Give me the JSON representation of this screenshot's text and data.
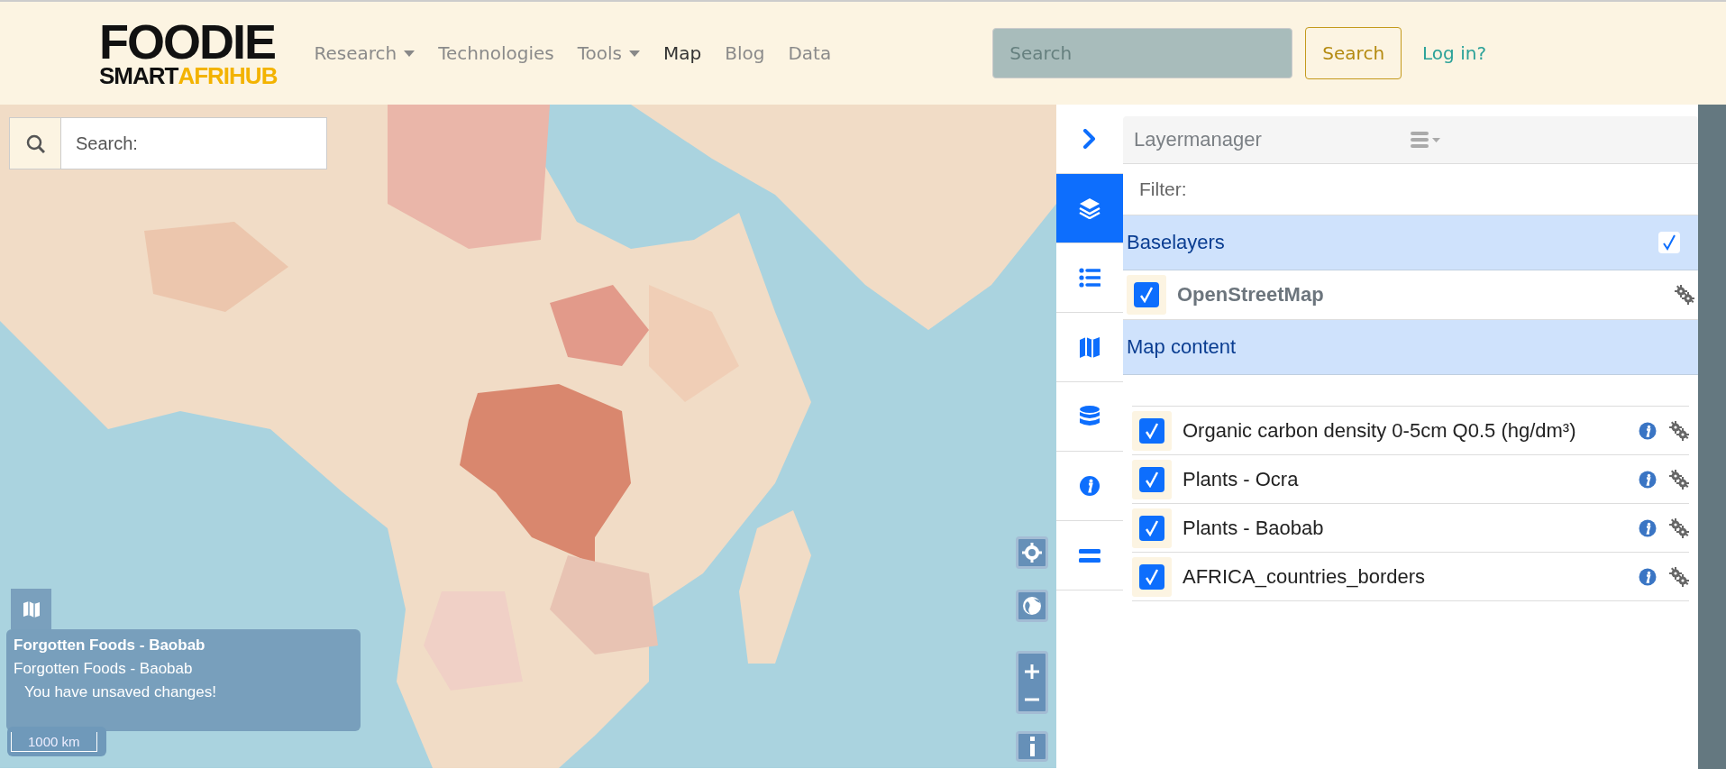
{
  "header": {
    "logo": {
      "title": "FOODIE",
      "subtitle_part_1": "SMART",
      "subtitle_part_2": "AFRIHUB"
    },
    "nav": [
      {
        "label": "Research",
        "dropdown": true,
        "selected": false
      },
      {
        "label": "Technologies",
        "dropdown": false,
        "selected": false
      },
      {
        "label": "Tools",
        "dropdown": true,
        "selected": false
      },
      {
        "label": "Map",
        "dropdown": false,
        "selected": true
      },
      {
        "label": "Blog",
        "dropdown": false,
        "selected": false
      },
      {
        "label": "Data",
        "dropdown": false,
        "selected": false
      }
    ],
    "search": {
      "placeholder": "Search"
    },
    "search_button": "Search",
    "login": "Log in?"
  },
  "map": {
    "kind": "picture",
    "search": {
      "placeholder": "Search:"
    },
    "info_box": {
      "title": "Forgotten Foods - Baobab",
      "name": "Forgotten Foods - Baobab",
      "message": "You have unsaved changes!"
    },
    "scale": "1000 km"
  },
  "side_tabs": [
    {
      "kind": "collapse",
      "selected": false
    },
    {
      "kind": "layers",
      "selected": true
    },
    {
      "kind": "legend",
      "selected": false
    },
    {
      "kind": "map",
      "selected": false
    },
    {
      "kind": "database",
      "selected": false
    },
    {
      "kind": "info",
      "selected": false
    },
    {
      "kind": "menu",
      "selected": false
    }
  ],
  "layer_manager": {
    "title": "Layermanager",
    "filter": {
      "placeholder": "Filter:"
    },
    "groups": [
      {
        "label": "Baselayers",
        "checked": true,
        "layers": [
          {
            "name": "OpenStreetMap",
            "checked": true
          }
        ]
      },
      {
        "label": "Map content",
        "layers": [
          {
            "name": "Organic carbon density 0-5cm Q0.5 (hg/dm³)",
            "checked": true
          },
          {
            "name": "Plants - Ocra",
            "checked": true
          },
          {
            "name": "Plants - Baobab",
            "checked": true
          },
          {
            "name": "AFRICA_countries_borders",
            "checked": true
          }
        ]
      }
    ]
  }
}
